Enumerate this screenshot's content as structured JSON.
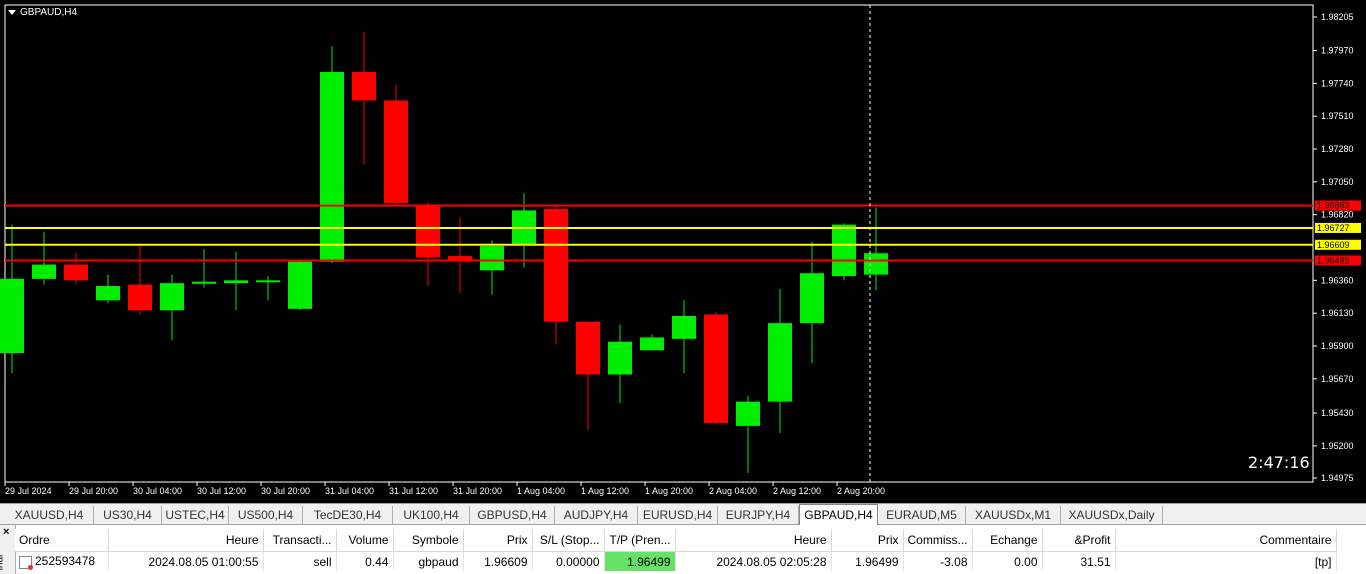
{
  "chart": {
    "symbol_label": "GBPAUD,H4",
    "countdown": "2:47:16",
    "colors": {
      "background": "#000000",
      "bull": "#00ee00",
      "bear": "#ff0000",
      "axis": "#ffffff",
      "sl_line": "#ff0000",
      "entry_line": "#ffff00"
    }
  },
  "chart_data": {
    "type": "candlestick",
    "ylim": [
      1.9474,
      1.9834
    ],
    "price_ticks": [
      "1.98205",
      "1.97970",
      "1.97740",
      "1.97510",
      "1.97280",
      "1.97050",
      "1.96820",
      "1.96360",
      "1.96130",
      "1.95900",
      "1.95670",
      "1.95430",
      "1.95200",
      "1.94975"
    ],
    "time_ticks": [
      "29 Jul 2024",
      "29 Jul 20:00",
      "30 Jul 04:00",
      "30 Jul 12:00",
      "30 Jul 20:00",
      "31 Jul 04:00",
      "31 Jul 12:00",
      "31 Jul 20:00",
      "1 Aug 04:00",
      "1 Aug 12:00",
      "1 Aug 20:00",
      "2 Aug 04:00",
      "2 Aug 12:00",
      "2 Aug 20:00"
    ],
    "candles": [
      {
        "o": 1.9585,
        "h": 1.9675,
        "l": 1.9571,
        "c": 1.9637
      },
      {
        "o": 1.9637,
        "h": 1.967,
        "l": 1.9633,
        "c": 1.9647
      },
      {
        "o": 1.9647,
        "h": 1.9655,
        "l": 1.9633,
        "c": 1.9636
      },
      {
        "o": 1.9622,
        "h": 1.964,
        "l": 1.962,
        "c": 1.9632
      },
      {
        "o": 1.9633,
        "h": 1.966,
        "l": 1.9612,
        "c": 1.9615
      },
      {
        "o": 1.9615,
        "h": 1.964,
        "l": 1.9594,
        "c": 1.9634
      },
      {
        "o": 1.9634,
        "h": 1.9658,
        "l": 1.9631,
        "c": 1.9635
      },
      {
        "o": 1.9634,
        "h": 1.9656,
        "l": 1.9615,
        "c": 1.9636
      },
      {
        "o": 1.9635,
        "h": 1.9639,
        "l": 1.9622,
        "c": 1.9636
      },
      {
        "o": 1.9616,
        "h": 1.965,
        "l": 1.9615,
        "c": 1.9649
      },
      {
        "o": 1.9649,
        "h": 1.98,
        "l": 1.9648,
        "c": 1.9782
      },
      {
        "o": 1.9782,
        "h": 1.981,
        "l": 1.9717,
        "c": 1.9762
      },
      {
        "o": 1.9762,
        "h": 1.9773,
        "l": 1.9688,
        "c": 1.969
      },
      {
        "o": 1.9689,
        "h": 1.9691,
        "l": 1.9632,
        "c": 1.9652
      },
      {
        "o": 1.9653,
        "h": 1.968,
        "l": 1.9627,
        "c": 1.965
      },
      {
        "o": 1.9643,
        "h": 1.9664,
        "l": 1.9626,
        "c": 1.966
      },
      {
        "o": 1.9661,
        "h": 1.9697,
        "l": 1.9645,
        "c": 1.9685
      },
      {
        "o": 1.9686,
        "h": 1.9688,
        "l": 1.9591,
        "c": 1.9607
      },
      {
        "o": 1.9607,
        "h": 1.9607,
        "l": 1.9531,
        "c": 1.957
      },
      {
        "o": 1.957,
        "h": 1.9605,
        "l": 1.955,
        "c": 1.9593
      },
      {
        "o": 1.9587,
        "h": 1.9598,
        "l": 1.9587,
        "c": 1.9596
      },
      {
        "o": 1.9595,
        "h": 1.9622,
        "l": 1.9571,
        "c": 1.9611
      },
      {
        "o": 1.9612,
        "h": 1.9614,
        "l": 1.9535,
        "c": 1.9536
      },
      {
        "o": 1.9534,
        "h": 1.9555,
        "l": 1.9501,
        "c": 1.9551
      },
      {
        "o": 1.9551,
        "h": 1.963,
        "l": 1.9529,
        "c": 1.9606
      },
      {
        "o": 1.9606,
        "h": 1.9663,
        "l": 1.9578,
        "c": 1.9641
      },
      {
        "o": 1.9639,
        "h": 1.9676,
        "l": 1.9636,
        "c": 1.9675
      },
      {
        "o": 1.964,
        "h": 1.9687,
        "l": 1.9629,
        "c": 1.9655
      }
    ],
    "horizontal_lines": [
      {
        "label": "1.96883",
        "value": 1.96883,
        "color": "#ff0000"
      },
      {
        "label": "1.96727",
        "value": 1.96727,
        "color": "#ffff00"
      },
      {
        "label": "1.96609",
        "value": 1.96609,
        "color": "#ffff00"
      },
      {
        "label": "1.96499",
        "value": 1.96499,
        "color": "#ff0000"
      }
    ]
  },
  "tabs": [
    {
      "label": "XAUUSD,H4",
      "active": false
    },
    {
      "label": "US30,H4",
      "active": false
    },
    {
      "label": "USTEC,H4",
      "active": false
    },
    {
      "label": "US500,H4",
      "active": false
    },
    {
      "label": "TecDE30,H4",
      "active": false
    },
    {
      "label": "UK100,H4",
      "active": false
    },
    {
      "label": "GBPUSD,H4",
      "active": false
    },
    {
      "label": "AUDJPY,H4",
      "active": false
    },
    {
      "label": "EURUSD,H4",
      "active": false
    },
    {
      "label": "EURJPY,H4",
      "active": false
    },
    {
      "label": "GBPAUD,H4",
      "active": true
    },
    {
      "label": "EURAUD,M5",
      "active": false
    },
    {
      "label": "XAUUSDx,M1",
      "active": false
    },
    {
      "label": "XAUUSDx,Daily",
      "active": false
    }
  ],
  "terminal": {
    "side_label": "inal",
    "close_glyph": "×",
    "columns": [
      "Ordre",
      "Heure",
      "Transacti...",
      "Volume",
      "Symbole",
      "Prix",
      "S/L (Stop...",
      "T/P (Pren...",
      "Heure",
      "Prix",
      "Commiss...",
      "Echange",
      "&Profit",
      "Commentaire"
    ],
    "row": {
      "order": "252593478",
      "open_time": "2024.08.05 01:00:55",
      "type": "sell",
      "volume": "0.44",
      "symbol": "gbpaud",
      "open_price": "1.96609",
      "sl": "0.00000",
      "tp": "1.96499",
      "close_time": "2024.08.05 02:05:28",
      "close_price": "1.96499",
      "commission": "-3.08",
      "swap": "0.00",
      "profit": "31.51",
      "comment": "[tp]"
    }
  }
}
